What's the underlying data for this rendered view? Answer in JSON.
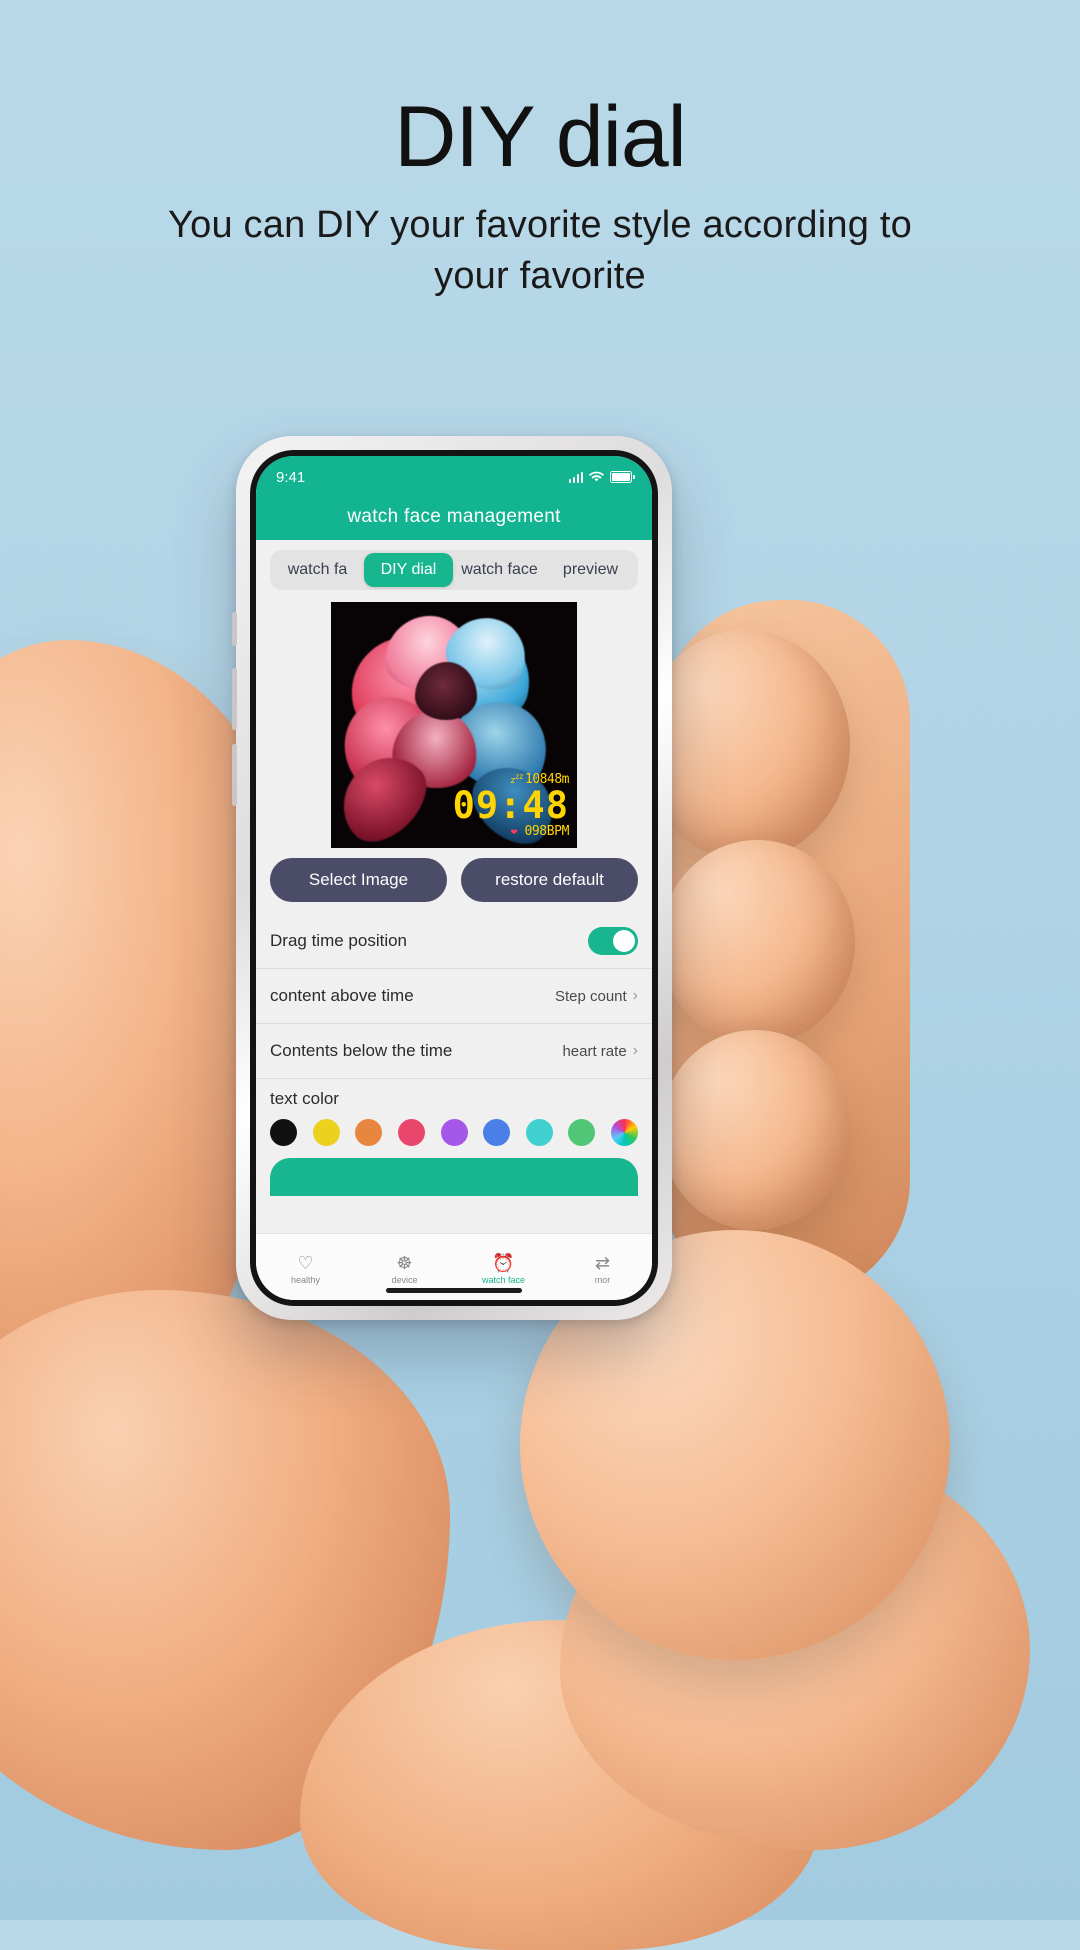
{
  "promo": {
    "title": "DIY dial",
    "subtitle": "You can DIY your favorite style according to your favorite"
  },
  "colors": {
    "background": "#b2d4e6",
    "brand_green": "#13b491",
    "tab_active_green": "#17b68f",
    "button_dark": "#4a4c68",
    "clock_yellow": "#ffd400",
    "heart_red": "#ff3b5c"
  },
  "phone": {
    "statusbar": {
      "time": "9:41",
      "signal_icon": "cellular-signal-icon",
      "wifi_icon": "wifi-icon",
      "battery_icon": "battery-full-icon"
    },
    "appbar": {
      "title": "watch face management"
    },
    "tabs": [
      {
        "label": "watch fa",
        "active": false
      },
      {
        "label": "DIY dial",
        "active": true
      },
      {
        "label": "watch face",
        "active": false
      },
      {
        "label": "preview",
        "active": false
      }
    ],
    "watchface": {
      "image_alt": "dahlia-flower-wallpaper",
      "sleep_icon": "zzz-icon",
      "steps_line": "10848m",
      "time": "09:48",
      "heart_icon": "heart-icon",
      "heart_line": "098BPM"
    },
    "buttons": {
      "select_image": "Select Image",
      "restore_default": "restore default"
    },
    "rows": [
      {
        "label": "Drag time position",
        "value": "",
        "control": "toggle",
        "toggle_on": true
      },
      {
        "label": "content above time",
        "value": "Step count",
        "control": "chevron"
      },
      {
        "label": "Contents below the time",
        "value": "heart rate",
        "control": "chevron"
      }
    ],
    "text_color": {
      "label": "text color",
      "swatches": [
        {
          "name": "black",
          "hex": "#111111"
        },
        {
          "name": "yellow",
          "hex": "#ecd21f"
        },
        {
          "name": "orange",
          "hex": "#e8853f"
        },
        {
          "name": "pink",
          "hex": "#e8476b"
        },
        {
          "name": "purple",
          "hex": "#a457e8"
        },
        {
          "name": "blue",
          "hex": "#4a7fe8"
        },
        {
          "name": "cyan",
          "hex": "#3fd0cf"
        },
        {
          "name": "green",
          "hex": "#4fc776"
        },
        {
          "name": "rainbow",
          "hex": "rainbow"
        }
      ]
    },
    "bottom_nav": [
      {
        "label": "healthy",
        "icon": "heart-pulse-icon",
        "active": false
      },
      {
        "label": "device",
        "icon": "devices-icon",
        "active": false
      },
      {
        "label": "watch face",
        "icon": "watch-icon",
        "active": true
      },
      {
        "label": "mor",
        "icon": "more-icon",
        "active": false
      }
    ]
  }
}
